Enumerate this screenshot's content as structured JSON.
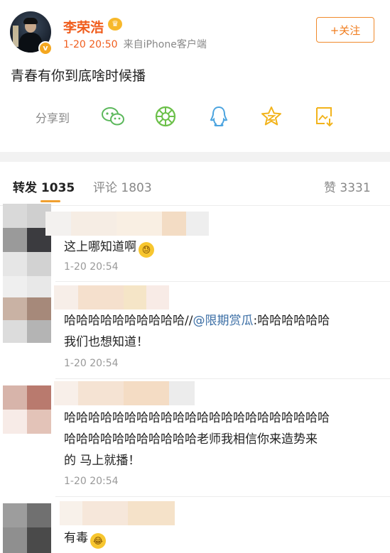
{
  "post": {
    "author": "李荣浩",
    "verified_badge": "v",
    "crown_badge": "♛",
    "time": "1-20 20:50",
    "source": "来自iPhone客户端",
    "follow_label": "+关注",
    "text": "青春有你到底啥时候播"
  },
  "share": {
    "label": "分享到",
    "targets": [
      "wechat-icon",
      "moments-icon",
      "qq-icon",
      "qzone-icon",
      "save-image-icon"
    ]
  },
  "tabs": {
    "repost": "转发 1035",
    "comment": "评论 1803",
    "likes": "赞 3331"
  },
  "comments": [
    {
      "text": "这上哪知道啊",
      "emoji": "😓",
      "time": "1-20 20:54"
    },
    {
      "prefix": "哈哈哈哈哈哈哈哈哈哈//",
      "mention": "@限期赏瓜",
      "rest": ":哈哈哈哈哈哈",
      "line2": "我们也想知道！",
      "time": "1-20 20:54"
    },
    {
      "line1": "哈哈哈哈哈哈哈哈哈哈哈哈哈哈哈哈哈哈哈哈哈哈",
      "line2": "哈哈哈哈哈哈哈哈哈哈哈老师我相信你来造势来",
      "line3": "的 马上就播！",
      "time": "1-20 20:54"
    },
    {
      "text": "有毒",
      "emoji": "😂"
    }
  ],
  "colors": {
    "accent": "#f05d1d",
    "follow_border": "#f08a2c",
    "mention": "#3b6ea5",
    "tab_indicator": "#f0a030"
  }
}
